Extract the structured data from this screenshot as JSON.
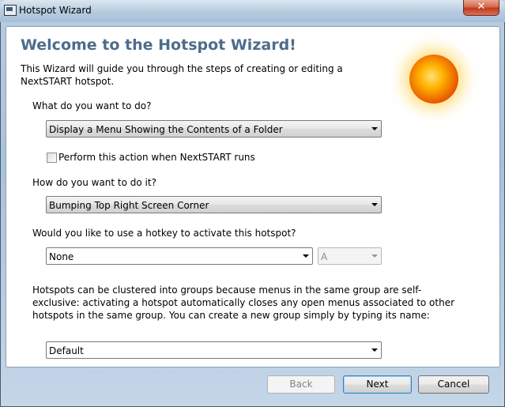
{
  "window": {
    "title": "Hotspot Wizard",
    "close_label": "✕"
  },
  "header": {
    "heading": "Welcome to the Hotspot Wizard!",
    "intro": "This Wizard will guide you through the steps of creating or editing a NextSTART hotspot."
  },
  "form": {
    "action_label": "What do you want to do?",
    "action_value": "Display a Menu Showing the Contents of a Folder",
    "on_start_label": "Perform this action when NextSTART runs",
    "on_start_checked": false,
    "trigger_label": "How do you want to do it?",
    "trigger_value": "Bumping Top Right Screen Corner",
    "hotkey_label": "Would you like to use a hotkey to activate this hotspot?",
    "hotkey_modifier_value": "None",
    "hotkey_key_value": "A",
    "group_description": "Hotspots can be clustered into groups because menus in the same group are self-exclusive: activating a hotspot automatically closes any open menus associated to other hotspots in the same group. You can create a new group simply by typing its name:",
    "group_value": "Default"
  },
  "footer": {
    "back_label": "Back",
    "next_label": "Next",
    "cancel_label": "Cancel"
  },
  "icons": {
    "app": "app-window-icon",
    "decoration": "sun-icon"
  }
}
